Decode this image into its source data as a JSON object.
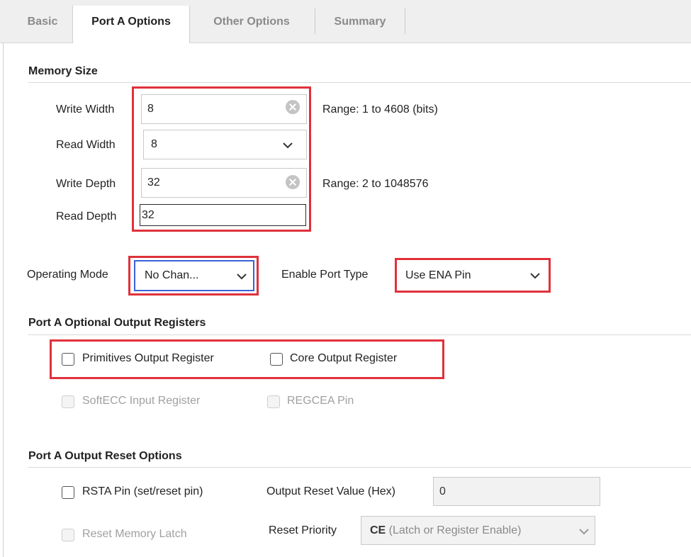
{
  "tabs": [
    {
      "label": "Basic",
      "active": false
    },
    {
      "label": "Port A Options",
      "active": true
    },
    {
      "label": "Other Options",
      "active": false
    },
    {
      "label": "Summary",
      "active": false
    }
  ],
  "memory_size": {
    "title": "Memory Size",
    "write_width": {
      "label": "Write Width",
      "value": "8",
      "range": "Range: 1 to 4608 (bits)"
    },
    "read_width": {
      "label": "Read Width",
      "value": "8"
    },
    "write_depth": {
      "label": "Write Depth",
      "value": "32",
      "range": "Range: 2 to 1048576"
    },
    "read_depth": {
      "label": "Read Depth",
      "value": "32"
    }
  },
  "operating_mode": {
    "label": "Operating Mode",
    "value": "No Chan..."
  },
  "enable_port_type": {
    "label": "Enable Port Type",
    "value": "Use ENA Pin"
  },
  "output_registers": {
    "title": "Port A Optional Output Registers",
    "primitives": {
      "label": "Primitives Output Register",
      "checked": false
    },
    "core": {
      "label": "Core Output Register",
      "checked": false
    },
    "softecc": {
      "label": "SoftECC Input Register",
      "checked": false,
      "disabled": true
    },
    "regcea": {
      "label": "REGCEA Pin",
      "checked": false,
      "disabled": true
    }
  },
  "reset_options": {
    "title": "Port A Output Reset Options",
    "rsta": {
      "label": "RSTA Pin (set/reset pin)",
      "checked": false
    },
    "output_reset_value": {
      "label": "Output Reset Value (Hex)",
      "value": "0"
    },
    "reset_memory_latch": {
      "label": "Reset Memory Latch",
      "checked": false,
      "disabled": true
    },
    "reset_priority": {
      "label": "Reset Priority",
      "value_strong": "CE",
      "value_rest": " (Latch or Register Enable)"
    }
  },
  "colors": {
    "highlight_red": "#e0313b",
    "highlight_blue": "#3a63d6"
  }
}
